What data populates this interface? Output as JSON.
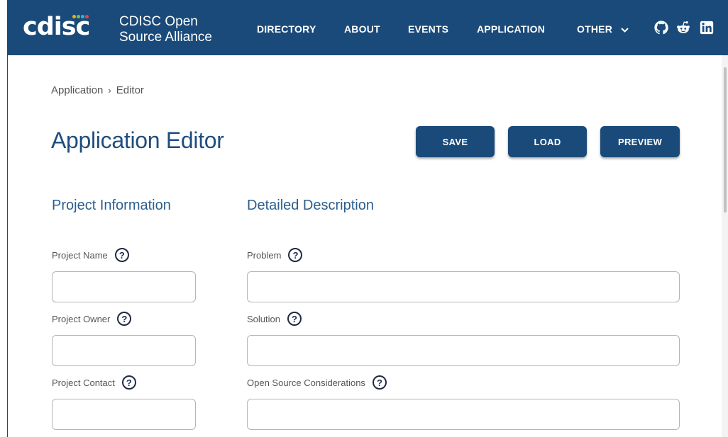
{
  "header": {
    "logo_text": "cdisc",
    "brand_title": "CDISC Open Source Alliance",
    "nav": [
      {
        "label": "DIRECTORY"
      },
      {
        "label": "ABOUT"
      },
      {
        "label": "EVENTS"
      },
      {
        "label": "APPLICATION"
      },
      {
        "label": "OTHER"
      }
    ],
    "social_icons": [
      "github-icon",
      "reddit-icon",
      "linkedin-icon"
    ],
    "colors": {
      "bar": "#1a4a7a",
      "logo_dots": [
        "#f4a81d",
        "#7cc242",
        "#3ab0e2",
        "#e8473c"
      ]
    }
  },
  "breadcrumb": {
    "items": [
      "Application",
      "Editor"
    ],
    "separator": "›"
  },
  "page": {
    "title": "Application Editor"
  },
  "toolbar": {
    "save_label": "SAVE",
    "load_label": "LOAD",
    "preview_label": "PREVIEW"
  },
  "sections": {
    "project_information": "Project Information",
    "detailed_description": "Detailed Description"
  },
  "fields": {
    "project_name": {
      "label": "Project Name",
      "value": ""
    },
    "project_owner": {
      "label": "Project Owner",
      "value": ""
    },
    "project_contact": {
      "label": "Project Contact",
      "value": ""
    },
    "problem": {
      "label": "Problem",
      "value": ""
    },
    "solution": {
      "label": "Solution",
      "value": ""
    },
    "open_source_considerations": {
      "label": "Open Source Considerations",
      "value": ""
    }
  },
  "help_glyph": "?"
}
